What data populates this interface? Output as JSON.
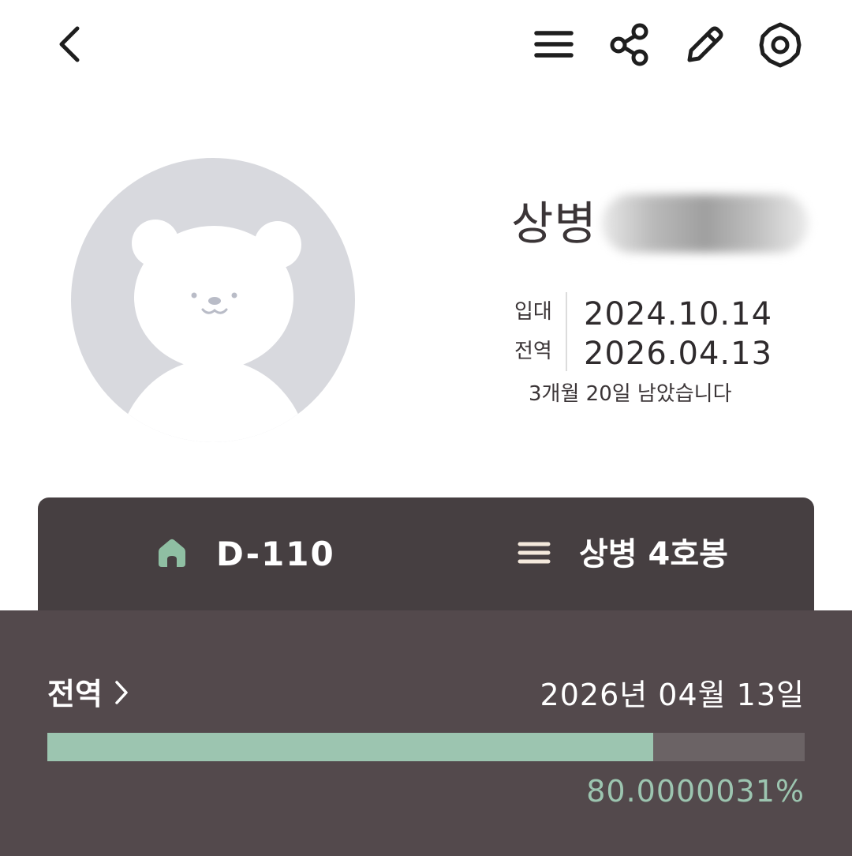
{
  "header": {
    "back_icon": "chevron-left-icon",
    "menu_icon": "hamburger-menu-icon",
    "share_icon": "share-icon",
    "edit_icon": "pencil-icon",
    "settings_icon": "gear-icon"
  },
  "profile": {
    "avatar_icon": "bear-avatar-icon",
    "rank": "상병",
    "enlist_label": "입대",
    "enlist_date": "2024.10.14",
    "discharge_label": "전역",
    "discharge_date": "2026.04.13",
    "remaining_text": "3개월 20일 남았습니다"
  },
  "summary": {
    "dday": "D-110",
    "grade": "상병 4호봉",
    "home_icon_color": "#8fbfa3",
    "list_icon_color": "#f4e9dc"
  },
  "progress": {
    "label": "전역",
    "date": "2026년 04월 13일",
    "percent_text": "80.0000031%",
    "fraction": 0.800000031,
    "fill_color": "#9cc5b0"
  }
}
